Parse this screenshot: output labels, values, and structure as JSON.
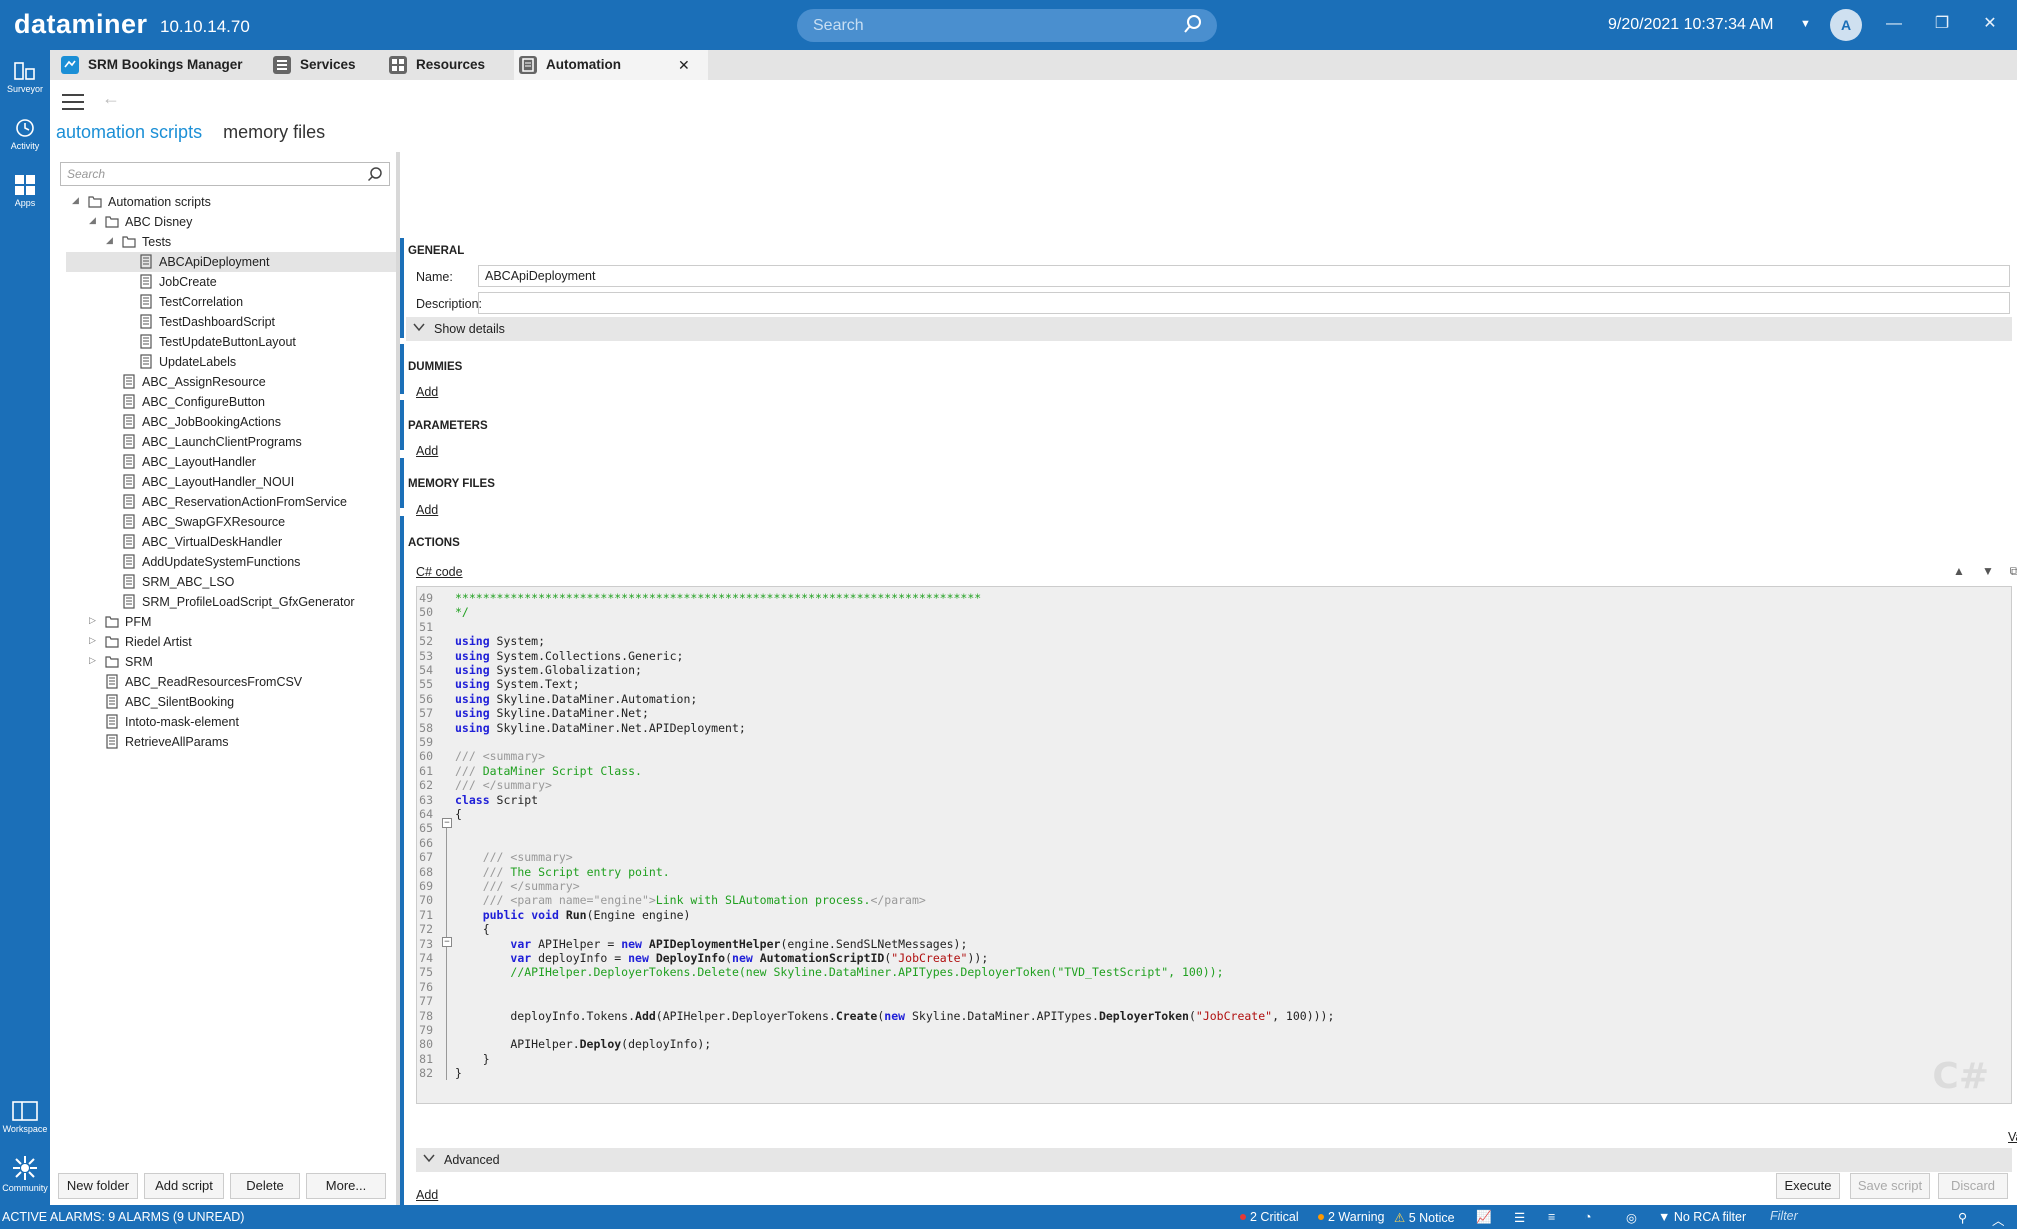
{
  "app": {
    "brand": "dataminer",
    "version": "10.10.14.70"
  },
  "topbar": {
    "search_placeholder": "Search",
    "datetime": "9/20/2021 10:37:34 AM",
    "avatar_letter": "A"
  },
  "rail": {
    "surveyor": "Surveyor",
    "activity": "Activity",
    "apps": "Apps",
    "workspace": "Workspace",
    "community": "Community"
  },
  "tabs": [
    {
      "label": "SRM Bookings Manager"
    },
    {
      "label": "Services"
    },
    {
      "label": "Resources"
    },
    {
      "label": "Automation",
      "close": "✕"
    }
  ],
  "module": {
    "nav_active": "automation scripts",
    "nav_other": "memory files"
  },
  "tree": {
    "search_placeholder": "Search",
    "nodes": [
      {
        "label": "Automation scripts",
        "type": "folder",
        "level": 0,
        "expander": "◢"
      },
      {
        "label": "ABC Disney",
        "type": "folder",
        "level": 1,
        "expander": "◢"
      },
      {
        "label": "Tests",
        "type": "folder",
        "level": 2,
        "expander": "◢"
      },
      {
        "label": "ABCApiDeployment",
        "type": "script",
        "level": 3,
        "selected": true
      },
      {
        "label": "JobCreate",
        "type": "script",
        "level": 3
      },
      {
        "label": "TestCorrelation",
        "type": "script",
        "level": 3
      },
      {
        "label": "TestDashboardScript",
        "type": "script",
        "level": 3
      },
      {
        "label": "TestUpdateButtonLayout",
        "type": "script",
        "level": 3
      },
      {
        "label": "UpdateLabels",
        "type": "script",
        "level": 3
      },
      {
        "label": "ABC_AssignResource",
        "type": "script",
        "level": 2
      },
      {
        "label": "ABC_ConfigureButton",
        "type": "script",
        "level": 2
      },
      {
        "label": "ABC_JobBookingActions",
        "type": "script",
        "level": 2
      },
      {
        "label": "ABC_LaunchClientPrograms",
        "type": "script",
        "level": 2
      },
      {
        "label": "ABC_LayoutHandler",
        "type": "script",
        "level": 2
      },
      {
        "label": "ABC_LayoutHandler_NOUI",
        "type": "script",
        "level": 2
      },
      {
        "label": "ABC_ReservationActionFromService",
        "type": "script",
        "level": 2
      },
      {
        "label": "ABC_SwapGFXResource",
        "type": "script",
        "level": 2
      },
      {
        "label": "ABC_VirtualDeskHandler",
        "type": "script",
        "level": 2
      },
      {
        "label": "AddUpdateSystemFunctions",
        "type": "script",
        "level": 2
      },
      {
        "label": "SRM_ABC_LSO",
        "type": "script",
        "level": 2
      },
      {
        "label": "SRM_ProfileLoadScript_GfxGenerator",
        "type": "script",
        "level": 2
      },
      {
        "label": "PFM",
        "type": "folder",
        "level": 1,
        "expander": "▷"
      },
      {
        "label": "Riedel Artist",
        "type": "folder",
        "level": 1,
        "expander": "▷"
      },
      {
        "label": "SRM",
        "type": "folder",
        "level": 1,
        "expander": "▷"
      },
      {
        "label": "ABC_ReadResourcesFromCSV",
        "type": "script",
        "level": 1
      },
      {
        "label": "ABC_SilentBooking",
        "type": "script",
        "level": 1
      },
      {
        "label": "Intoto-mask-element",
        "type": "script",
        "level": 1
      },
      {
        "label": "RetrieveAllParams",
        "type": "script",
        "level": 1
      }
    ]
  },
  "tree_buttons": {
    "new_folder": "New folder",
    "add_script": "Add script",
    "delete": "Delete",
    "more": "More..."
  },
  "editor": {
    "general": "GENERAL",
    "name_label": "Name:",
    "name_value": "ABCApiDeployment",
    "description_label": "Description:",
    "description_value": "",
    "show_details": "Show details",
    "dummies": "DUMMIES",
    "parameters": "PARAMETERS",
    "memory_files": "MEMORY FILES",
    "actions": "ACTIONS",
    "add": "Add",
    "code_title": "C# code",
    "advanced": "Advanced",
    "validate": "Validate",
    "watermark": "C#"
  },
  "code_lines": [
    {
      "n": "49",
      "html": "<span class=\"cmt\">****************************************************************************</span>"
    },
    {
      "n": "50",
      "html": "<span class=\"cmt\">*/</span>"
    },
    {
      "n": "51",
      "html": ""
    },
    {
      "n": "52",
      "html": "<span class=\"kw\">using</span> System;"
    },
    {
      "n": "53",
      "html": "<span class=\"kw\">using</span> System.Collections.Generic;"
    },
    {
      "n": "54",
      "html": "<span class=\"kw\">using</span> System.Globalization;"
    },
    {
      "n": "55",
      "html": "<span class=\"kw\">using</span> System.Text;"
    },
    {
      "n": "56",
      "html": "<span class=\"kw\">using</span> Skyline.DataMiner.Automation;"
    },
    {
      "n": "57",
      "html": "<span class=\"kw\">using</span> Skyline.DataMiner.Net;"
    },
    {
      "n": "58",
      "html": "<span class=\"kw\">using</span> Skyline.DataMiner.Net.APIDeployment;"
    },
    {
      "n": "59",
      "html": ""
    },
    {
      "n": "60",
      "html": "<span class=\"doc\">/// &lt;summary&gt;</span>"
    },
    {
      "n": "61",
      "html": "<span class=\"doc\">///</span> <span class=\"cmt\">DataMiner Script Class.</span>"
    },
    {
      "n": "62",
      "html": "<span class=\"doc\">/// &lt;/summary&gt;</span>"
    },
    {
      "n": "63",
      "html": "<span class=\"kw\">class</span> Script"
    },
    {
      "n": "64",
      "html": "{"
    },
    {
      "n": "65",
      "html": ""
    },
    {
      "n": "66",
      "html": ""
    },
    {
      "n": "67",
      "html": "    <span class=\"doc\">/// &lt;summary&gt;</span>"
    },
    {
      "n": "68",
      "html": "    <span class=\"doc\">///</span> <span class=\"cmt\">The Script entry point.</span>"
    },
    {
      "n": "69",
      "html": "    <span class=\"doc\">/// &lt;/summary&gt;</span>"
    },
    {
      "n": "70",
      "html": "    <span class=\"doc\">/// &lt;param name=\"engine\"&gt;</span><span class=\"cmt\">Link with SLAutomation process.</span><span class=\"doc\">&lt;/param&gt;</span>"
    },
    {
      "n": "71",
      "html": "    <span class=\"kw\">public</span> <span class=\"kw\">void</span> <span class=\"fn\">Run</span>(Engine engine)"
    },
    {
      "n": "72",
      "html": "    {"
    },
    {
      "n": "73",
      "html": "        <span class=\"kw\">var</span> APIHelper = <span class=\"kw\">new</span> <span class=\"fn\">APIDeploymentHelper</span>(engine.SendSLNetMessages);"
    },
    {
      "n": "74",
      "html": "        <span class=\"kw\">var</span> deployInfo = <span class=\"kw\">new</span> <span class=\"fn\">DeployInfo</span>(<span class=\"kw\">new</span> <span class=\"fn\">AutomationScriptID</span>(<span class=\"str\">\"JobCreate\"</span>));"
    },
    {
      "n": "75",
      "html": "        <span class=\"cmt\">//APIHelper.DeployerTokens.Delete(new Skyline.DataMiner.APITypes.DeployerToken(\"TVD_TestScript\", 100));</span>"
    },
    {
      "n": "76",
      "html": ""
    },
    {
      "n": "77",
      "html": ""
    },
    {
      "n": "78",
      "html": "        deployInfo.Tokens.<span class=\"fn\">Add</span>(APIHelper.DeployerTokens.<span class=\"fn\">Create</span>(<span class=\"kw\">new</span> Skyline.DataMiner.APITypes.<span class=\"fn\">DeployerToken</span>(<span class=\"str\">\"JobCreate\"</span>, 100)));"
    },
    {
      "n": "79",
      "html": ""
    },
    {
      "n": "80",
      "html": "        APIHelper.<span class=\"fn\">Deploy</span>(deployInfo);"
    },
    {
      "n": "81",
      "html": "    }"
    },
    {
      "n": "82",
      "html": "}"
    }
  ],
  "action_buttons": {
    "execute": "Execute",
    "save_script": "Save script",
    "discard": "Discard"
  },
  "statusbar": {
    "alarms": "ACTIVE ALARMS: 9 ALARMS (9 UNREAD)",
    "critical": "2 Critical",
    "warning": "2 Warning",
    "notice": "5 Notice",
    "rca": "No RCA filter",
    "filter_placeholder": "Filter"
  },
  "colors": {
    "brand_blue": "#1b6fb8",
    "critical": "#e53935",
    "warning": "#ff9800",
    "notice": "#ffd54f"
  }
}
